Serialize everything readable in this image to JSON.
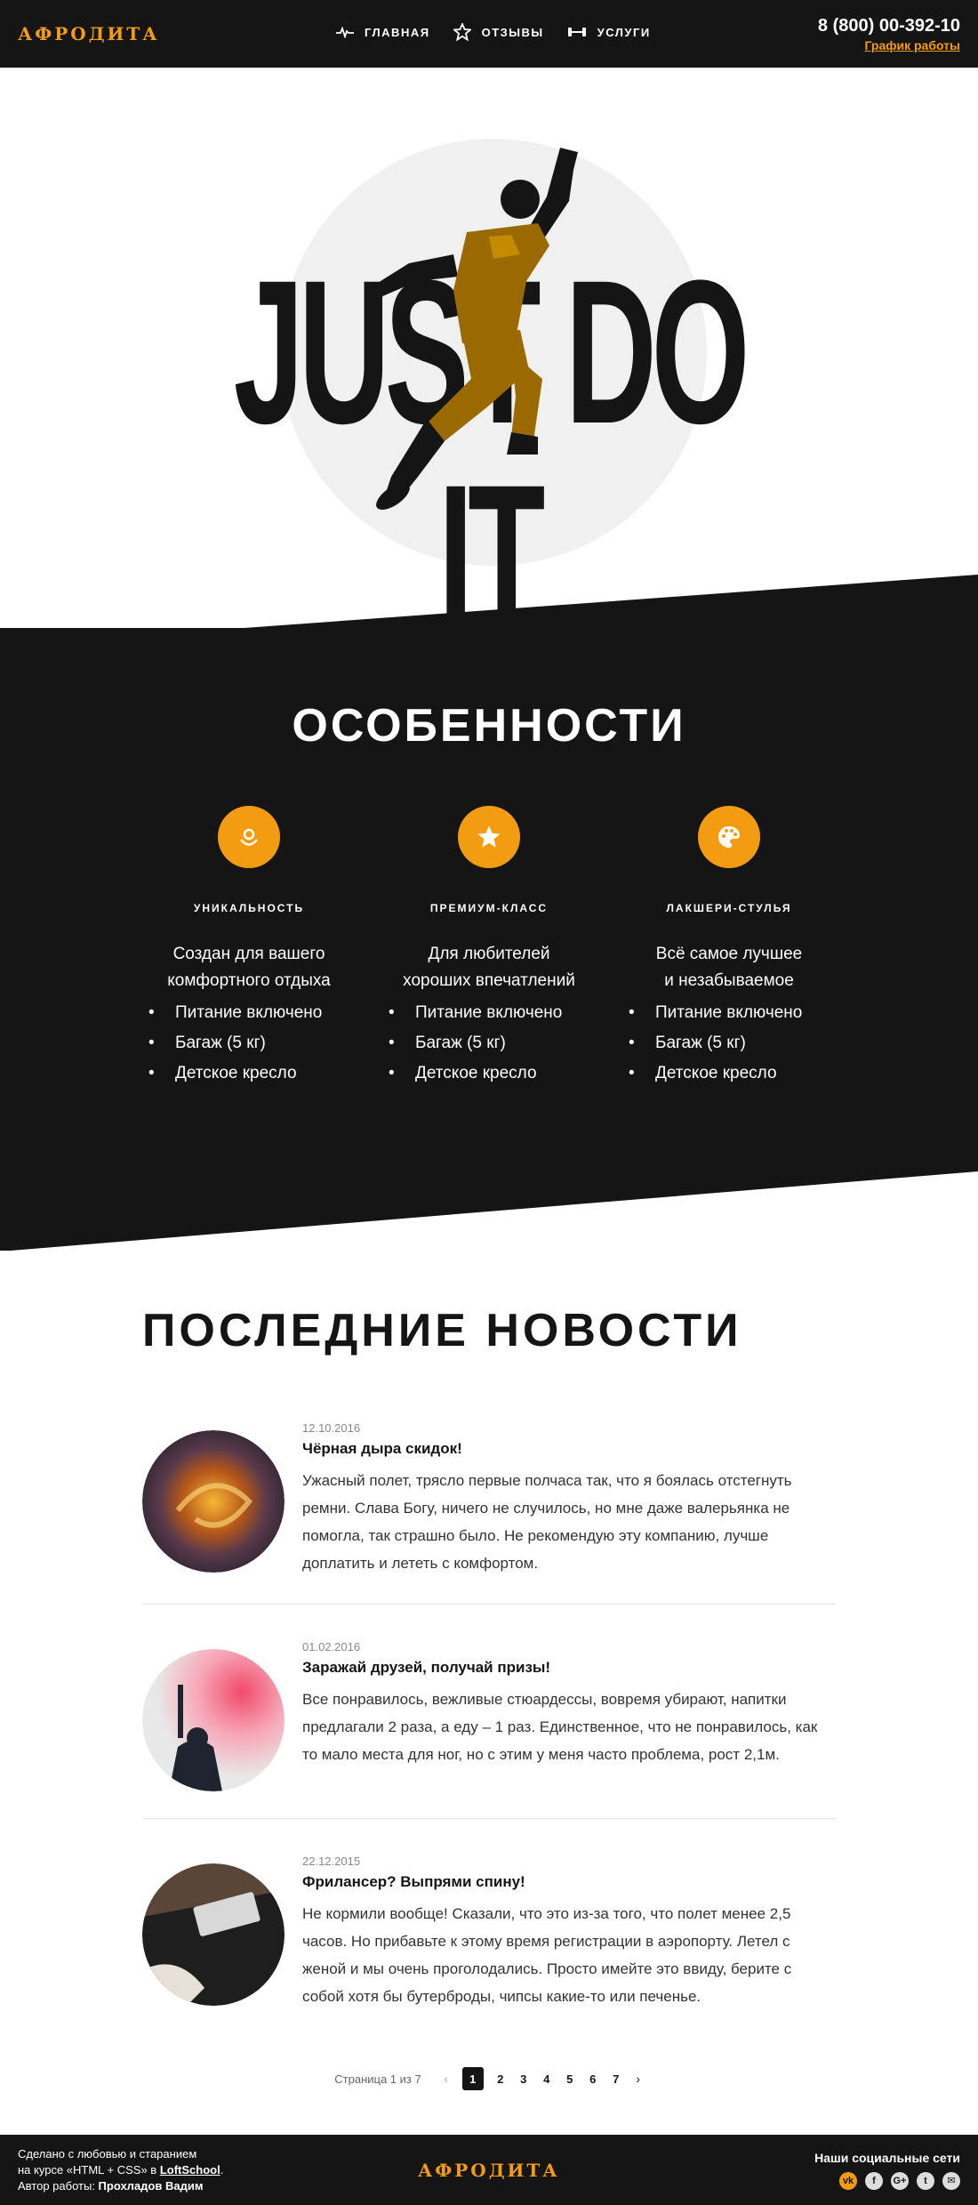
{
  "header": {
    "logo": "АФРОДИТА",
    "nav": [
      {
        "label": "ГЛАВНАЯ",
        "icon": "pulse-icon"
      },
      {
        "label": "ОТЗЫВЫ",
        "icon": "star-icon"
      },
      {
        "label": "УСЛУГИ",
        "icon": "dumbbell-icon"
      }
    ],
    "phone": "8 (800) 00-392-10",
    "schedule": "График работы"
  },
  "hero": {
    "title": "JUST DO IT"
  },
  "features": {
    "title": "ОСОБЕННОСТИ",
    "items": [
      {
        "icon": "flower-icon",
        "title": "уникальность",
        "desc1": "Создан для вашего",
        "desc2": "комфортного отдыха",
        "list": [
          "Питание включено",
          "Багаж (5 кг)",
          "Детское кресло"
        ]
      },
      {
        "icon": "star-icon",
        "title": "премиум-класс",
        "desc1": "Для любителей",
        "desc2": "хороших впечатлений",
        "list": [
          "Питание включено",
          "Багаж (5 кг)",
          "Детское кресло"
        ]
      },
      {
        "icon": "palette-icon",
        "title": "лакшери-стулья",
        "desc1": "Всё самое лучшее",
        "desc2": "и незабываемое",
        "list": [
          "Питание включено",
          "Багаж (5 кг)",
          "Детское кресло"
        ]
      }
    ]
  },
  "news": {
    "title": "ПОСЛЕДНИЕ НОВОСТИ",
    "items": [
      {
        "date": "12.10.2016",
        "title": "Чёрная дыра скидок!",
        "text": "Ужасный полет, трясло первые полчаса так, что я боялась отстегнуть ремни. Слава Богу, ничего не случилось, но мне даже валерьянка не помогла, так страшно было. Не рекомендую эту компанию, лучше доплатить и лететь с комфортом."
      },
      {
        "date": "01.02.2016",
        "title": "Заражай друзей, получай призы!",
        "text": "Все понравилось, вежливые стюардессы, вовремя убирают, напитки предлагали 2 раза, а еду – 1 раз. Единственное, что не понравилось, как то мало места для ног, но с этим у меня часто проблема, рост 2,1м."
      },
      {
        "date": "22.12.2015",
        "title": "Фрилансер? Выпрями спину!",
        "text": "Не кормили вообще! Сказали, что это из-за того, что полет менее 2,5 часов. Но прибавьте к этому время регистрации в аэропорту. Летел с женой и мы очень проголодались. Просто имейте это ввиду, берите с собой хотя бы бутерброды, чипсы какие-то или печенье."
      }
    ]
  },
  "pagination": {
    "info": "Страница 1 из 7",
    "pages": [
      "1",
      "2",
      "3",
      "4",
      "5",
      "6",
      "7"
    ],
    "current": "1",
    "prev": "‹",
    "next": "›"
  },
  "footer": {
    "line1": "Сделано с любовью и старанием",
    "line2_prefix": "на курсе «HTML + CSS» в ",
    "line2_link": "LoftSchool",
    "line2_suffix": ".",
    "line3_prefix": "Автор работы: ",
    "line3_author": "Прохладов Вадим",
    "logo": "АФРОДИТА",
    "social_title": "Наши социальные сети",
    "socials": [
      {
        "name": "vk-icon",
        "glyph": "vk"
      },
      {
        "name": "facebook-icon",
        "glyph": "f"
      },
      {
        "name": "google-plus-icon",
        "glyph": "G+"
      },
      {
        "name": "twitter-icon",
        "glyph": "t"
      },
      {
        "name": "email-icon",
        "glyph": "✉"
      }
    ]
  },
  "colors": {
    "accent": "#f39c12",
    "dark": "#151515",
    "light": "#ffffff"
  }
}
